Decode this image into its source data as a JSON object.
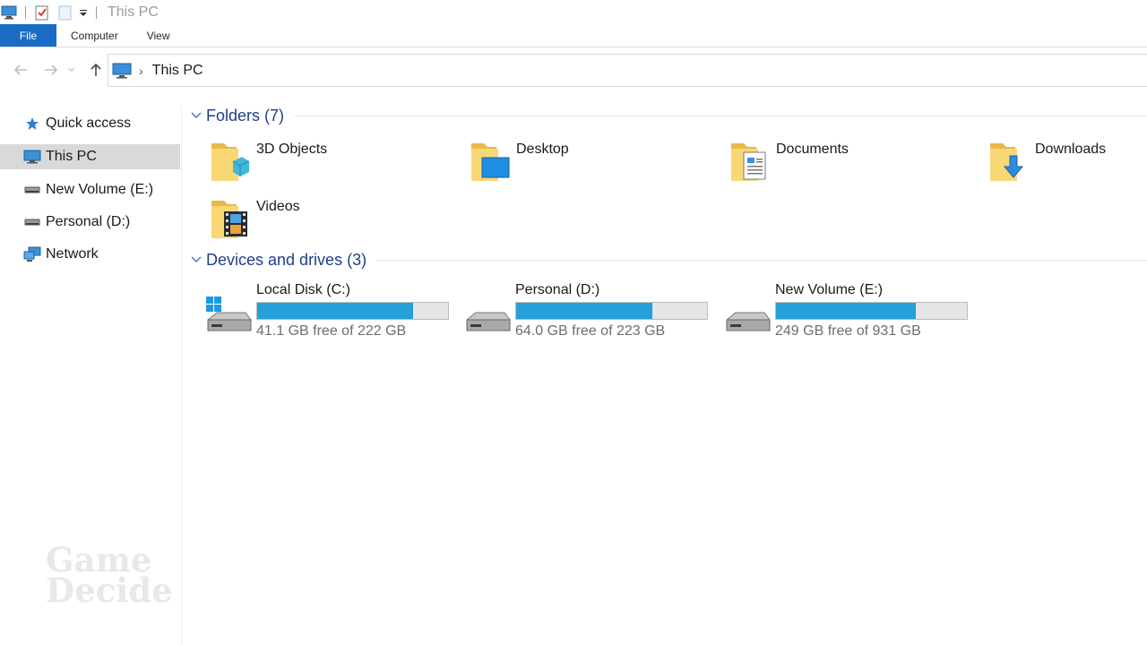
{
  "window": {
    "title": "This PC"
  },
  "ribbon": {
    "tabs": [
      {
        "label": "File"
      },
      {
        "label": "Computer"
      },
      {
        "label": "View"
      }
    ]
  },
  "navigation": {
    "back_icon": "arrow-left-icon",
    "forward_icon": "arrow-right-icon",
    "recent_icon": "chevron-down-icon",
    "up_icon": "arrow-up-icon",
    "breadcrumb": [
      "This PC"
    ]
  },
  "sidebar": {
    "items": [
      {
        "label": "Quick access",
        "icon": "star-icon"
      },
      {
        "label": "This PC",
        "icon": "computer-icon",
        "selected": true
      },
      {
        "label": "New Volume (E:)",
        "icon": "drive-icon"
      },
      {
        "label": "Personal (D:)",
        "icon": "drive-icon"
      },
      {
        "label": "Network",
        "icon": "network-icon"
      }
    ]
  },
  "watermark": {
    "line1": "Game",
    "line2": "Decide"
  },
  "folders": {
    "header": "Folders (7)",
    "items": [
      {
        "name": "3D Objects",
        "icon": "3d-objects-folder-icon"
      },
      {
        "name": "Desktop",
        "icon": "desktop-folder-icon"
      },
      {
        "name": "Documents",
        "icon": "documents-folder-icon"
      },
      {
        "name": "Downloads",
        "icon": "downloads-folder-icon"
      },
      {
        "name": "Videos",
        "icon": "videos-folder-icon"
      }
    ]
  },
  "devices": {
    "header": "Devices and drives (3)",
    "items": [
      {
        "name": "Local Disk (C:)",
        "free_text": "41.1 GB free of 222 GB",
        "used_fraction": 0.815,
        "system": true
      },
      {
        "name": "Personal (D:)",
        "free_text": "64.0 GB free of 223 GB",
        "used_fraction": 0.713
      },
      {
        "name": "New Volume (E:)",
        "free_text": "249 GB free of 931 GB",
        "used_fraction": 0.733
      }
    ]
  },
  "colors": {
    "accent": "#1a6cc4",
    "group_header": "#1e3f8a",
    "usage_bar": "#26a0da",
    "selection": "#d9d9d9"
  }
}
